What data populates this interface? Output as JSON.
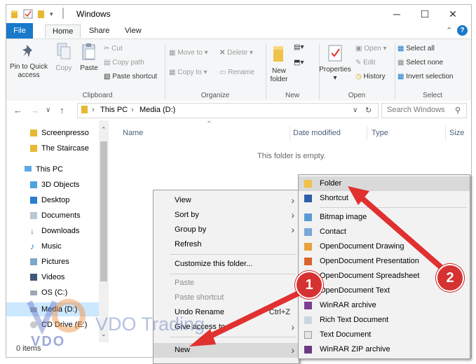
{
  "window": {
    "title": "Windows"
  },
  "ribbon_tabs": [
    "File",
    "Home",
    "Share",
    "View"
  ],
  "ribbon": {
    "clipboard": {
      "pin_label_1": "Pin to Quick",
      "pin_label_2": "access",
      "copy": "Copy",
      "paste": "Paste",
      "cut": "Cut",
      "copy_path": "Copy path",
      "paste_shortcut": "Paste shortcut",
      "group": "Clipboard"
    },
    "organize": {
      "move_to": "Move to",
      "copy_to": "Copy to",
      "delete": "Delete",
      "rename": "Rename",
      "group": "Organize"
    },
    "new": {
      "new_folder_1": "New",
      "new_folder_2": "folder",
      "group": "New"
    },
    "open": {
      "properties": "Properties",
      "open": "Open",
      "edit": "Edit",
      "history": "History",
      "group": "Open"
    },
    "select": {
      "select_all": "Select all",
      "select_none": "Select none",
      "invert": "Invert selection",
      "group": "Select"
    }
  },
  "address": {
    "this_pc": "This PC",
    "drive": "Media (D:)",
    "search_placeholder": "Search Windows"
  },
  "nav": [
    {
      "label": "Screenpresso",
      "icon": "folder-icon"
    },
    {
      "label": "The Staircase",
      "icon": "folder-icon"
    },
    {
      "label": "This PC",
      "icon": "computer-icon"
    },
    {
      "label": "3D Objects",
      "icon": "cube-icon"
    },
    {
      "label": "Desktop",
      "icon": "desktop-icon"
    },
    {
      "label": "Documents",
      "icon": "documents-icon"
    },
    {
      "label": "Downloads",
      "icon": "downloads-icon"
    },
    {
      "label": "Music",
      "icon": "music-icon"
    },
    {
      "label": "Pictures",
      "icon": "pictures-icon"
    },
    {
      "label": "Videos",
      "icon": "videos-icon"
    },
    {
      "label": "OS (C:)",
      "icon": "drive-icon"
    },
    {
      "label": "Media (D:)",
      "icon": "drive-icon"
    },
    {
      "label": "CD Drive (E:)",
      "icon": "cd-drive-icon"
    }
  ],
  "columns": {
    "name": "Name",
    "date": "Date modified",
    "type": "Type",
    "size": "Size"
  },
  "empty_message": "This folder is empty.",
  "status": {
    "items": "0 items"
  },
  "context_menu": {
    "view": "View",
    "sort_by": "Sort by",
    "group_by": "Group by",
    "refresh": "Refresh",
    "customize": "Customize this folder...",
    "paste": "Paste",
    "paste_shortcut": "Paste shortcut",
    "undo_rename": "Undo Rename",
    "undo_shortcut": "Ctrl+Z",
    "give_access": "Give access to",
    "new": "New"
  },
  "submenu": [
    {
      "label": "Folder",
      "icon": "folder-icon"
    },
    {
      "label": "Shortcut",
      "icon": "shortcut-icon"
    },
    {
      "label": "Bitmap image",
      "icon": "bitmap-icon"
    },
    {
      "label": "Contact",
      "icon": "contact-icon"
    },
    {
      "label": "OpenDocument Drawing",
      "icon": "odg-icon"
    },
    {
      "label": "OpenDocument Presentation",
      "icon": "odp-icon"
    },
    {
      "label": "OpenDocument Spreadsheet",
      "icon": "ods-icon"
    },
    {
      "label": "OpenDocument Text",
      "icon": "odt-icon"
    },
    {
      "label": "WinRAR archive",
      "icon": "winrar-icon"
    },
    {
      "label": "Rich Text Document",
      "icon": "rtf-icon"
    },
    {
      "label": "Text Document",
      "icon": "text-icon"
    },
    {
      "label": "WinRAR ZIP archive",
      "icon": "winrar-zip-icon"
    }
  ],
  "callouts": {
    "one": "1",
    "two": "2"
  },
  "watermark": {
    "brand": "VDO Trading",
    "logo": "VDO"
  },
  "colors": {
    "accent": "#1979ca",
    "callout": "#d63232",
    "selection": "#cce8ff"
  }
}
